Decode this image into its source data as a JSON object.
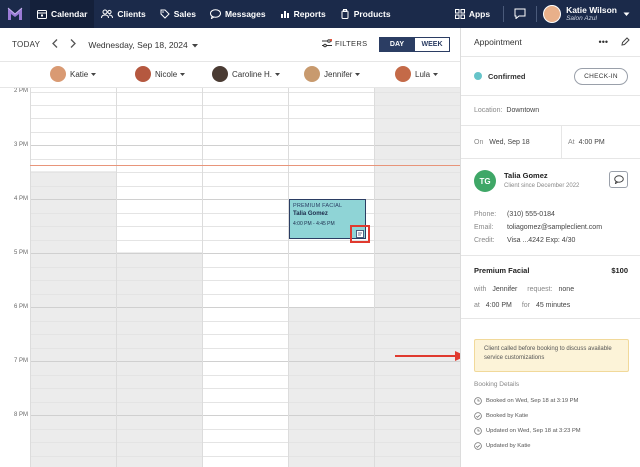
{
  "nav": {
    "items": [
      {
        "label": "Calendar",
        "icon": "calendar-icon"
      },
      {
        "label": "Clients",
        "icon": "clients-icon"
      },
      {
        "label": "Sales",
        "icon": "sales-tag-icon"
      },
      {
        "label": "Messages",
        "icon": "messages-icon"
      },
      {
        "label": "Reports",
        "icon": "reports-icon"
      },
      {
        "label": "Products",
        "icon": "products-icon"
      }
    ],
    "apps_label": "Apps",
    "user_name": "Katie Wilson",
    "user_location": "Salon Azul"
  },
  "toolbar": {
    "today_label": "TODAY",
    "date_label": "Wednesday, Sep 18, 2024",
    "filters_label": "FILTERS",
    "view_day": "DAY",
    "view_week": "WEEK"
  },
  "staff": [
    {
      "name": "Katie"
    },
    {
      "name": "Nicole"
    },
    {
      "name": "Caroline H."
    },
    {
      "name": "Jennifer"
    },
    {
      "name": "Lula"
    }
  ],
  "time_labels": [
    "2 PM",
    "3 PM",
    "4 PM",
    "5 PM",
    "6 PM",
    "7 PM",
    "8 PM"
  ],
  "appointment_card": {
    "service": "PREMIUM FACIAL",
    "client": "Talia Gomez",
    "time": "4:00 PM - 4:45 PM"
  },
  "panel": {
    "title": "Appointment",
    "status": "Confirmed",
    "checkin_label": "CHECK-IN",
    "location_label": "Location:",
    "location_value": "Downtown",
    "on_label": "On",
    "on_value": "Wed, Sep 18",
    "at_label": "At",
    "at_value": "4:00 PM",
    "client_initials": "TG",
    "client_name": "Talia Gomez",
    "client_since": "Client since December 2022",
    "phone_label": "Phone:",
    "phone_value": "(310) 555-0184",
    "email_label": "Email:",
    "email_value": "toliagomez@sampleclient.com",
    "credit_label": "Credit:",
    "credit_value": "Visa    ...4242   Exp: 4/30",
    "service_name": "Premium Facial",
    "service_price": "$100",
    "with_label": "with",
    "with_value": "Jennifer",
    "request_label": "request:",
    "request_value": "none",
    "at2_label": "at",
    "at2_value": "4:00 PM",
    "for_label": "for",
    "for_value": "45 minutes",
    "note": "Client called before booking to discuss available service customizations",
    "booking_details_title": "Booking Details",
    "booking_details": [
      "Booked on Wed, Sep 18 at 3:19 PM",
      "Booked by Katie",
      "Updated on Wed, Sep 18 at 3:23 PM",
      "Updated by Katie"
    ]
  },
  "colors": {
    "nav_bg": "#1b2a4a",
    "accent": "#2b3d63",
    "appointment": "#8fd4d6",
    "confirmed_dot": "#66c4c9",
    "highlight_red": "#e03a2f",
    "client_avatar": "#3fa767",
    "note_bg": "#fcf3d8"
  }
}
